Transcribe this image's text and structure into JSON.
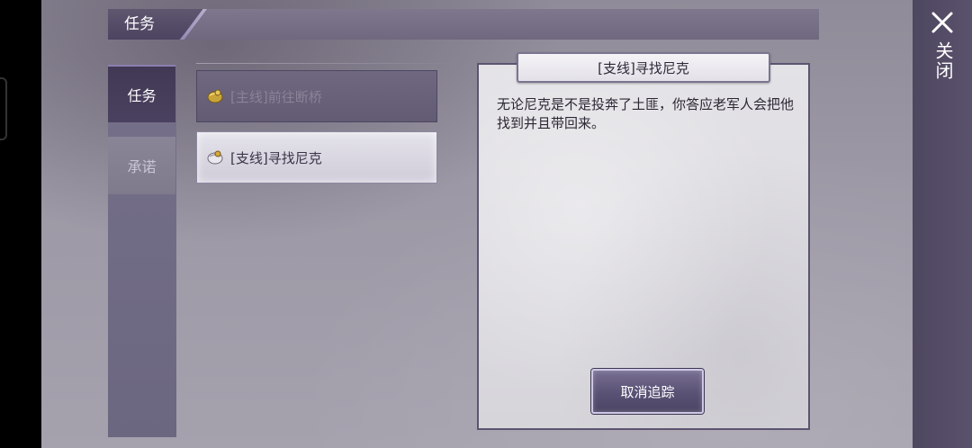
{
  "header": {
    "title": "任务"
  },
  "close": {
    "label": "关闭"
  },
  "tabs": [
    {
      "label": "任务",
      "active": true
    },
    {
      "label": "承诺",
      "active": false
    }
  ],
  "quests": [
    {
      "label": "[主线]前往断桥",
      "selected": false
    },
    {
      "label": "[支线]寻找尼克",
      "selected": true
    }
  ],
  "detail": {
    "title": "[支线]寻找尼克",
    "description": "无论尼克是不是投奔了土匪，你答应老军人会把他找到并且带回来。",
    "button_label": "取消追踪"
  },
  "colors": {
    "accent_purple": "#5a5275",
    "panel_bg": "#9c98a5",
    "parchment": "#dcdbe0"
  },
  "icons": {
    "close": "close-x-icon",
    "main_quest": "gold-scroll-icon",
    "side_quest": "silver-scroll-icon"
  }
}
